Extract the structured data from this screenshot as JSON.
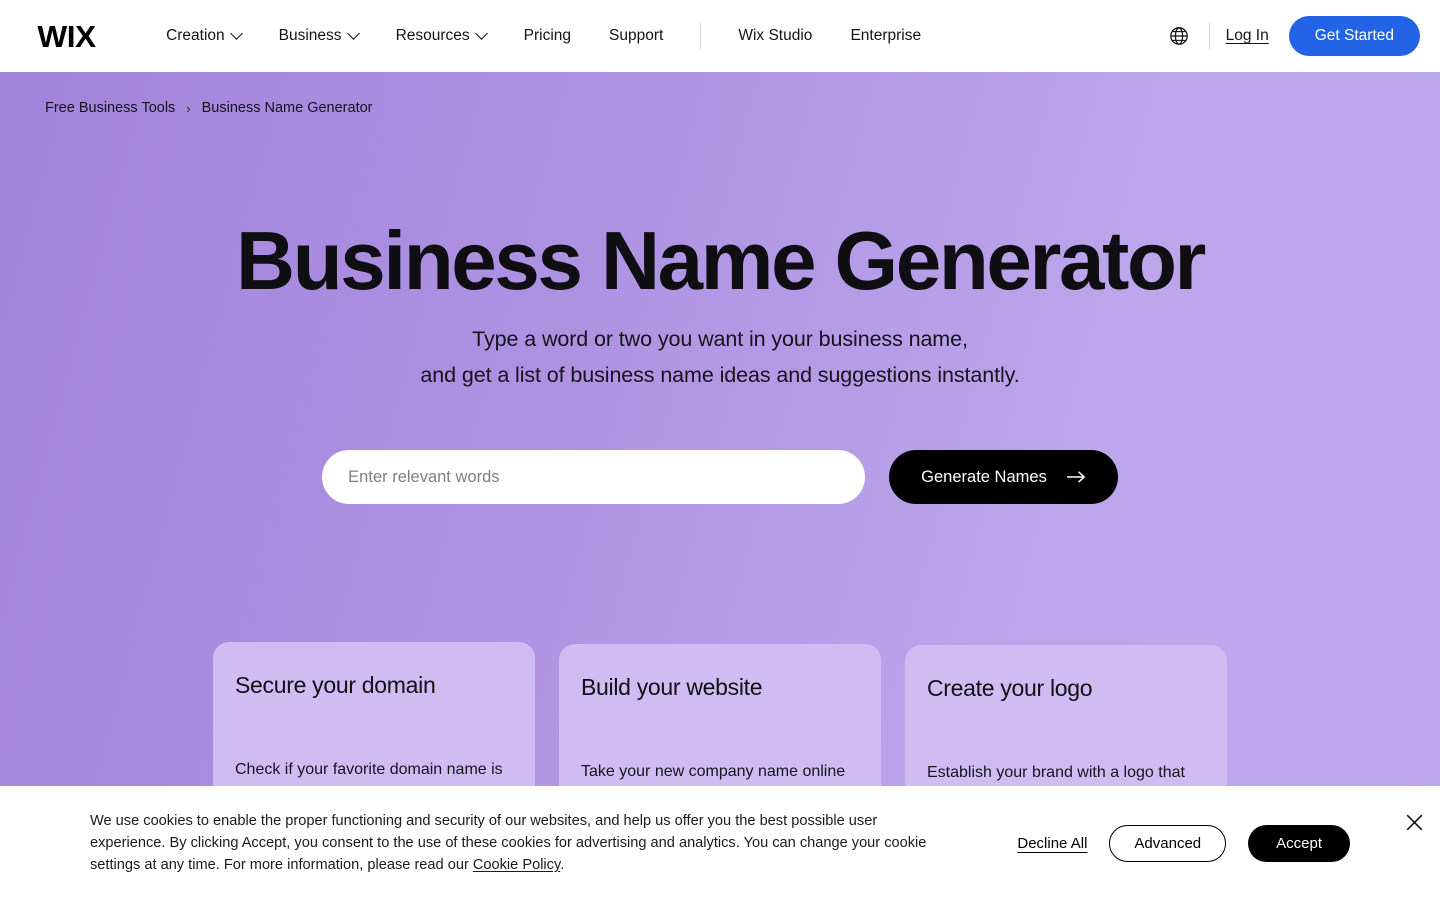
{
  "header": {
    "logo": "WIX",
    "nav": [
      {
        "label": "Creation",
        "has_dropdown": true
      },
      {
        "label": "Business",
        "has_dropdown": true
      },
      {
        "label": "Resources",
        "has_dropdown": true
      },
      {
        "label": "Pricing",
        "has_dropdown": false
      },
      {
        "label": "Support",
        "has_dropdown": false
      }
    ],
    "nav_secondary": [
      {
        "label": "Wix Studio"
      },
      {
        "label": "Enterprise"
      }
    ],
    "language_icon": "globe-icon",
    "login_label": "Log In",
    "get_started_label": "Get Started",
    "accent_color": "#2264e5"
  },
  "breadcrumb": {
    "parent": "Free Business Tools",
    "separator": "›",
    "current": "Business Name Generator"
  },
  "hero": {
    "title": "Business Name Generator",
    "subtitle_line1": "Type a word or two you want in your business name,",
    "subtitle_line2": "and get a list of business name ideas and suggestions instantly.",
    "background_from": "#a283db",
    "background_to": "#bfa9ee"
  },
  "search": {
    "placeholder": "Enter relevant words",
    "value": "",
    "button_label": "Generate Names",
    "button_icon": "arrow-right-icon"
  },
  "cards": [
    {
      "title": "Secure your domain",
      "body": "Check if your favorite domain name is"
    },
    {
      "title": "Build your website",
      "body": "Take your new company name online"
    },
    {
      "title": "Create your logo",
      "body": "Establish your brand with a logo that"
    }
  ],
  "card_background": "#cebcf3",
  "cookie_banner": {
    "text_part1": "We use cookies to enable the proper functioning and security of our websites, and help us offer you the best possible user experience. By clicking Accept, you consent to the use of these cookies for advertising and analytics. You can change your cookie settings at any time. For more information, please read our ",
    "link_label": "Cookie Policy",
    "text_part2": ".",
    "decline_label": "Decline All",
    "advanced_label": "Advanced",
    "accept_label": "Accept",
    "close_icon": "close-icon"
  }
}
